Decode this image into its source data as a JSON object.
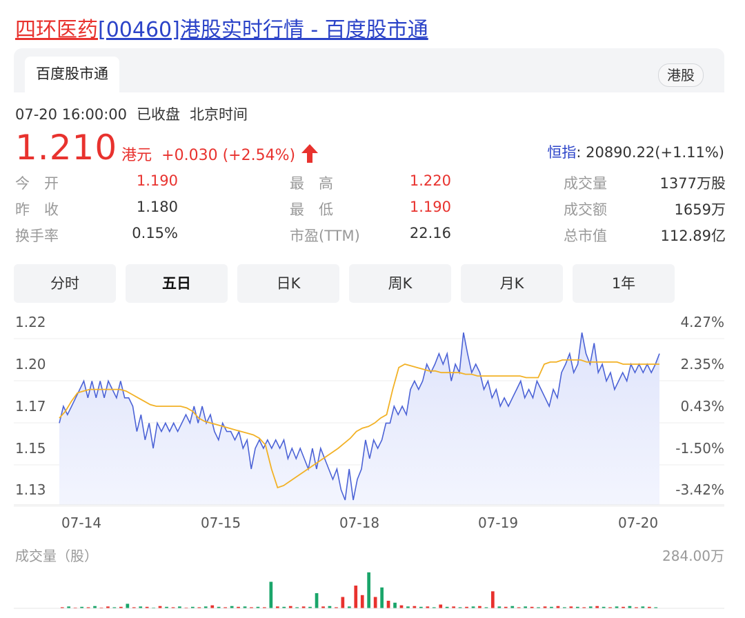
{
  "header": {
    "title_name": "四环医药",
    "title_rest": "[00460]港股实时行情 - 百度股市通"
  },
  "tabbar": {
    "active_tab": "百度股市通",
    "market_tag": "港股"
  },
  "status": {
    "datetime": "07-20 16:00:00",
    "state": "已收盘",
    "timezone": "北京时间"
  },
  "quote": {
    "price": "1.210",
    "currency": "港元",
    "change": "+0.030 (+2.54%)",
    "direction": "up",
    "index_label": "恒指",
    "index_value": ": 20890.22(+1.11%)"
  },
  "stats": [
    {
      "label": "今　开",
      "value": "1.190",
      "color": "red"
    },
    {
      "label": "最　高",
      "value": "1.220",
      "color": "red"
    },
    {
      "label": "成交量",
      "value": "1377万股",
      "color": "normal"
    },
    {
      "label": "昨　收",
      "value": "1.180",
      "color": "normal"
    },
    {
      "label": "最　低",
      "value": "1.190",
      "color": "red"
    },
    {
      "label": "成交额",
      "value": "1659万",
      "color": "normal"
    },
    {
      "label": "换手率",
      "value": "0.15%",
      "color": "normal"
    },
    {
      "label": "市盈(TTM)",
      "value": "22.16",
      "color": "normal"
    },
    {
      "label": "总市值",
      "value": "112.89亿",
      "color": "normal"
    }
  ],
  "period_tabs": [
    {
      "label": "分时",
      "active": false
    },
    {
      "label": "五日",
      "active": true
    },
    {
      "label": "日K",
      "active": false
    },
    {
      "label": "周K",
      "active": false
    },
    {
      "label": "月K",
      "active": false
    },
    {
      "label": "1年",
      "active": false
    }
  ],
  "colors": {
    "up": "#e8322e",
    "down": "#1aa56a",
    "price_line": "#4b62d6",
    "avg_line": "#f2b125",
    "fill": "#e4e8fb",
    "link": "#2b43c8"
  },
  "chart_data": {
    "type": "line",
    "y_ticks": [
      "1.22",
      "1.20",
      "1.17",
      "1.15",
      "1.13"
    ],
    "pct_ticks": [
      "4.27%",
      "2.35%",
      "0.43%",
      "-1.50%",
      "-3.42%"
    ],
    "x_ticks": [
      "07-14",
      "07-15",
      "07-18",
      "07-19",
      "07-20"
    ],
    "ylim": [
      1.13,
      1.22
    ],
    "grid": true,
    "series": [
      {
        "role": "price",
        "values": [
          1.165,
          1.175,
          1.17,
          1.175,
          1.18,
          1.185,
          1.19,
          1.18,
          1.19,
          1.18,
          1.19,
          1.18,
          1.19,
          1.185,
          1.18,
          1.19,
          1.18,
          1.18,
          1.175,
          1.16,
          1.17,
          1.155,
          1.165,
          1.15,
          1.165,
          1.16,
          1.165,
          1.16,
          1.165,
          1.16,
          1.165,
          1.17,
          1.165,
          1.175,
          1.165,
          1.175,
          1.165,
          1.17,
          1.16,
          1.155,
          1.165,
          1.16,
          1.16,
          1.155,
          1.16,
          1.15,
          1.155,
          1.14,
          1.15,
          1.155,
          1.15,
          1.155,
          1.15,
          1.155,
          1.15,
          1.155,
          1.145,
          1.15,
          1.145,
          1.15,
          1.145,
          1.14,
          1.15,
          1.14,
          1.15,
          1.145,
          1.14,
          1.135,
          1.14,
          1.13,
          1.125,
          1.14,
          1.125,
          1.135,
          1.14,
          1.155,
          1.145,
          1.155,
          1.15,
          1.155,
          1.165,
          1.165,
          1.175,
          1.17,
          1.175,
          1.17,
          1.185,
          1.19,
          1.185,
          1.19,
          1.2,
          1.195,
          1.2,
          1.205,
          1.2,
          1.205,
          1.19,
          1.2,
          1.195,
          1.215,
          1.205,
          1.195,
          1.2,
          1.195,
          1.185,
          1.19,
          1.18,
          1.185,
          1.175,
          1.18,
          1.175,
          1.18,
          1.185,
          1.19,
          1.18,
          1.185,
          1.18,
          1.19,
          1.185,
          1.18,
          1.175,
          1.185,
          1.18,
          1.195,
          1.2,
          1.205,
          1.195,
          1.2,
          1.215,
          1.205,
          1.2,
          1.21,
          1.195,
          1.2,
          1.19,
          1.195,
          1.185,
          1.19,
          1.195,
          1.19,
          1.2,
          1.195,
          1.2,
          1.195,
          1.2,
          1.195,
          1.2,
          1.205
        ],
        "note_values_in_price": true
      },
      {
        "role": "average",
        "values": [
          1.168,
          1.172,
          1.178,
          1.183,
          1.184,
          1.185,
          1.185,
          1.185,
          1.185,
          1.185,
          1.185,
          1.184,
          1.182,
          1.18,
          1.178,
          1.176,
          1.175,
          1.175,
          1.175,
          1.175,
          1.175,
          1.174,
          1.172,
          1.168,
          1.166,
          1.165,
          1.164,
          1.163,
          1.162,
          1.161,
          1.16,
          1.159,
          1.158,
          1.156,
          1.152,
          1.14,
          1.131,
          1.132,
          1.134,
          1.136,
          1.138,
          1.14,
          1.142,
          1.144,
          1.146,
          1.148,
          1.15,
          1.153,
          1.156,
          1.16,
          1.162,
          1.163,
          1.165,
          1.168,
          1.17,
          1.185,
          1.198,
          1.2,
          1.199,
          1.198,
          1.197,
          1.196,
          1.196,
          1.195,
          1.195,
          1.195,
          1.195,
          1.194,
          1.194,
          1.193,
          1.193,
          1.193,
          1.193,
          1.193,
          1.193,
          1.193,
          1.193,
          1.192,
          1.192,
          1.192,
          1.2,
          1.201,
          1.201,
          1.202,
          1.202,
          1.202,
          1.202,
          1.201,
          1.201,
          1.201,
          1.201,
          1.201,
          1.201,
          1.2,
          1.2,
          1.2,
          1.2,
          1.2,
          1.2,
          1.2
        ]
      }
    ]
  },
  "volume": {
    "label": "成交量（股）",
    "max_label": "284.00万",
    "bars": [
      {
        "v": 0.03,
        "c": "up"
      },
      {
        "v": 0.05,
        "c": "down"
      },
      {
        "v": 0.02,
        "c": "up"
      },
      {
        "v": 0.04,
        "c": "down"
      },
      {
        "v": 0.03,
        "c": "up"
      },
      {
        "v": 0.06,
        "c": "down"
      },
      {
        "v": 0.02,
        "c": "up"
      },
      {
        "v": 0.05,
        "c": "up"
      },
      {
        "v": 0.03,
        "c": "down"
      },
      {
        "v": 0.04,
        "c": "up"
      },
      {
        "v": 0.12,
        "c": "down"
      },
      {
        "v": 0.03,
        "c": "up"
      },
      {
        "v": 0.05,
        "c": "down"
      },
      {
        "v": 0.04,
        "c": "up"
      },
      {
        "v": 0.02,
        "c": "down"
      },
      {
        "v": 0.06,
        "c": "up"
      },
      {
        "v": 0.04,
        "c": "down"
      },
      {
        "v": 0.03,
        "c": "up"
      },
      {
        "v": 0.05,
        "c": "down"
      },
      {
        "v": 0.02,
        "c": "up"
      },
      {
        "v": 0.04,
        "c": "down"
      },
      {
        "v": 0.03,
        "c": "up"
      },
      {
        "v": 0.05,
        "c": "down"
      },
      {
        "v": 0.08,
        "c": "up"
      },
      {
        "v": 0.04,
        "c": "down"
      },
      {
        "v": 0.03,
        "c": "up"
      },
      {
        "v": 0.06,
        "c": "down"
      },
      {
        "v": 0.04,
        "c": "up"
      },
      {
        "v": 0.05,
        "c": "down"
      },
      {
        "v": 0.03,
        "c": "up"
      },
      {
        "v": 0.04,
        "c": "down"
      },
      {
        "v": 0.03,
        "c": "up"
      },
      {
        "v": 0.7,
        "c": "down"
      },
      {
        "v": 0.05,
        "c": "up"
      },
      {
        "v": 0.04,
        "c": "down"
      },
      {
        "v": 0.06,
        "c": "up"
      },
      {
        "v": 0.03,
        "c": "down"
      },
      {
        "v": 0.05,
        "c": "up"
      },
      {
        "v": 0.04,
        "c": "down"
      },
      {
        "v": 0.4,
        "c": "down"
      },
      {
        "v": 0.05,
        "c": "up"
      },
      {
        "v": 0.06,
        "c": "down"
      },
      {
        "v": 0.03,
        "c": "up"
      },
      {
        "v": 0.3,
        "c": "up"
      },
      {
        "v": 0.05,
        "c": "down"
      },
      {
        "v": 0.6,
        "c": "up"
      },
      {
        "v": 0.35,
        "c": "up"
      },
      {
        "v": 0.95,
        "c": "down"
      },
      {
        "v": 0.3,
        "c": "up"
      },
      {
        "v": 0.55,
        "c": "down"
      },
      {
        "v": 0.2,
        "c": "up"
      },
      {
        "v": 0.15,
        "c": "down"
      },
      {
        "v": 0.08,
        "c": "up"
      },
      {
        "v": 0.05,
        "c": "down"
      },
      {
        "v": 0.06,
        "c": "up"
      },
      {
        "v": 0.04,
        "c": "down"
      },
      {
        "v": 0.05,
        "c": "up"
      },
      {
        "v": 0.03,
        "c": "down"
      },
      {
        "v": 0.1,
        "c": "up"
      },
      {
        "v": 0.04,
        "c": "down"
      },
      {
        "v": 0.05,
        "c": "up"
      },
      {
        "v": 0.03,
        "c": "down"
      },
      {
        "v": 0.04,
        "c": "up"
      },
      {
        "v": 0.05,
        "c": "down"
      },
      {
        "v": 0.06,
        "c": "up"
      },
      {
        "v": 0.03,
        "c": "down"
      },
      {
        "v": 0.45,
        "c": "up"
      },
      {
        "v": 0.05,
        "c": "down"
      },
      {
        "v": 0.04,
        "c": "up"
      },
      {
        "v": 0.06,
        "c": "down"
      },
      {
        "v": 0.03,
        "c": "up"
      },
      {
        "v": 0.05,
        "c": "down"
      },
      {
        "v": 0.04,
        "c": "up"
      },
      {
        "v": 0.03,
        "c": "down"
      },
      {
        "v": 0.05,
        "c": "up"
      },
      {
        "v": 0.04,
        "c": "down"
      },
      {
        "v": 0.06,
        "c": "up"
      },
      {
        "v": 0.03,
        "c": "down"
      },
      {
        "v": 0.05,
        "c": "up"
      },
      {
        "v": 0.04,
        "c": "down"
      },
      {
        "v": 0.03,
        "c": "up"
      },
      {
        "v": 0.05,
        "c": "down"
      },
      {
        "v": 0.06,
        "c": "up"
      },
      {
        "v": 0.04,
        "c": "down"
      },
      {
        "v": 0.03,
        "c": "up"
      },
      {
        "v": 0.05,
        "c": "down"
      },
      {
        "v": 0.04,
        "c": "up"
      },
      {
        "v": 0.06,
        "c": "down"
      },
      {
        "v": 0.03,
        "c": "up"
      },
      {
        "v": 0.05,
        "c": "down"
      },
      {
        "v": 0.04,
        "c": "up"
      },
      {
        "v": 0.03,
        "c": "down"
      }
    ]
  }
}
